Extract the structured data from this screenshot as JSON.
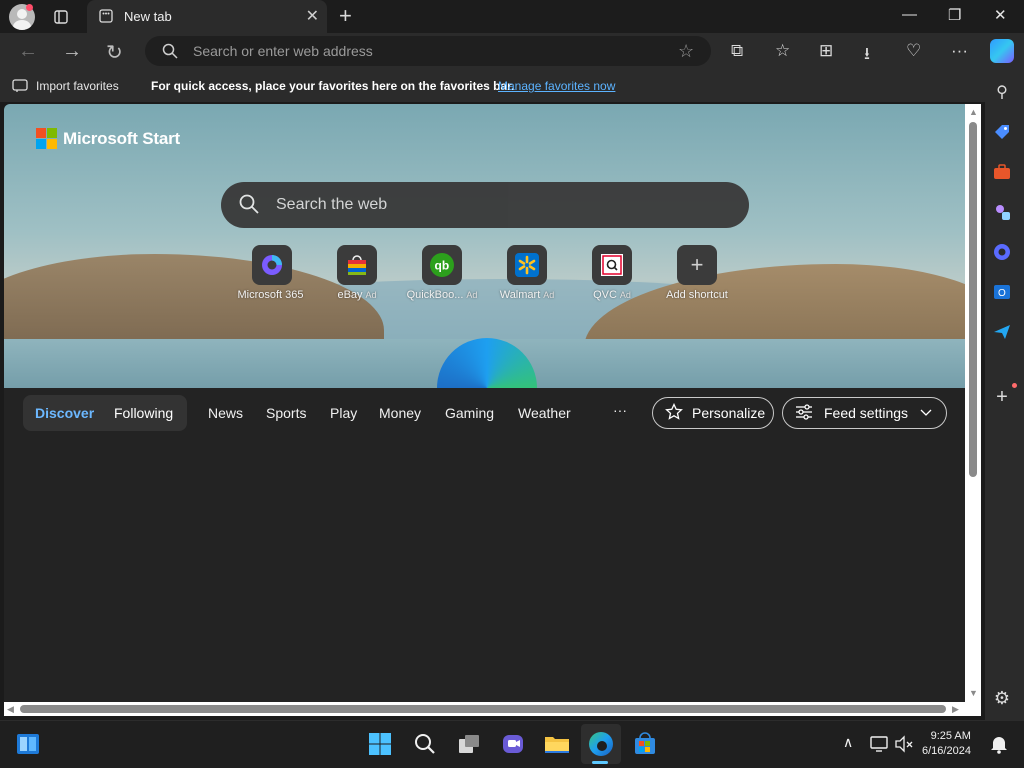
{
  "browser": {
    "tab_title": "New tab",
    "new_tab_label": "+",
    "window_buttons": {
      "minimize": "—",
      "restore": "❐",
      "close": "✕"
    }
  },
  "toolbar": {
    "address_placeholder": "Search or enter web address"
  },
  "favorites_bar": {
    "import_label": "Import favorites",
    "message": "For quick access, place your favorites here on the favorites bar.",
    "manage_link": "Manage favorites now"
  },
  "page": {
    "brand": "Microsoft Start",
    "search_placeholder": "Search the web",
    "shortcuts": [
      {
        "label": "Microsoft 365",
        "ad": ""
      },
      {
        "label": "eBay",
        "ad": "Ad"
      },
      {
        "label": "QuickBoo...",
        "ad": "Ad"
      },
      {
        "label": "Walmart",
        "ad": "Ad"
      },
      {
        "label": "QVC",
        "ad": "Ad"
      },
      {
        "label": "Add shortcut",
        "ad": ""
      }
    ],
    "feed": {
      "tabs": [
        "Discover",
        "Following"
      ],
      "links": [
        "News",
        "Sports",
        "Play",
        "Money",
        "Gaming",
        "Weather"
      ],
      "more": "···",
      "personalize": "Personalize",
      "feed_settings": "Feed settings"
    }
  },
  "taskbar": {
    "time": "9:25 AM",
    "date": "6/16/2024"
  },
  "colors": {
    "accent_link": "#5cb3ff",
    "discover_active": "#6cb8ff",
    "ms_logo": [
      "#f25022",
      "#7fba00",
      "#00a4ef",
      "#ffb900"
    ]
  }
}
